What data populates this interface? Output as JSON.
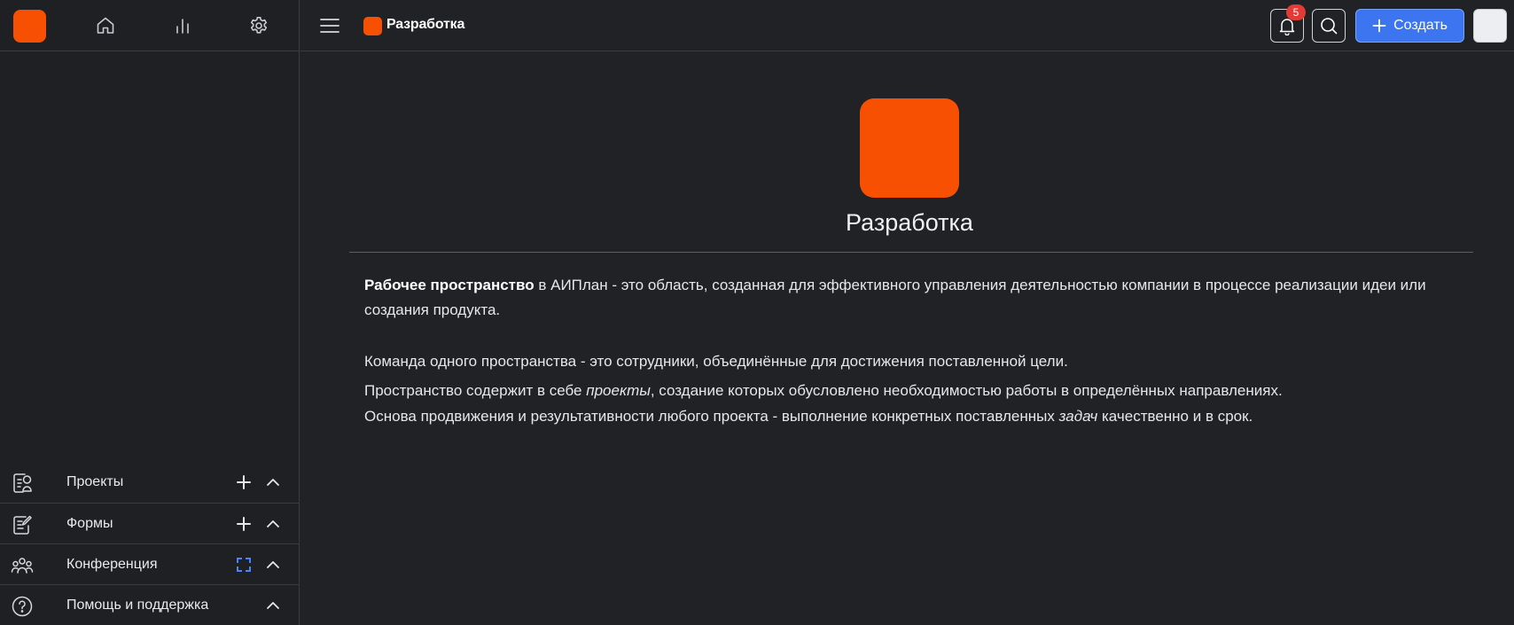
{
  "header": {
    "breadcrumb": "Разработка",
    "notifications_count": "5",
    "create_label": "Создать"
  },
  "sidebar": {
    "items": [
      {
        "label": "Проекты",
        "icon": "projects-icon",
        "action": "plus"
      },
      {
        "label": "Формы",
        "icon": "forms-icon",
        "action": "plus"
      },
      {
        "label": "Конференция",
        "icon": "people-icon",
        "action": "expand"
      },
      {
        "label": "Помощь и поддержка",
        "icon": "help-icon",
        "action": "none"
      }
    ]
  },
  "workspace": {
    "title": "Разработка",
    "p1_bold": "Рабочее пространство",
    "p1_rest": " в АИПлан - это область, созданная для эффективного управления деятельностью компании в процессе реализации идеи или создания продукта.",
    "p2": "Команда одного пространства - это сотрудники, объединённые для достижения поставленной цели.",
    "p3_a": "Пространство содержит в себе ",
    "p3_b": "проекты",
    "p3_c": ", создание которых обусловлено необходимостью работы в определённых направлениях.",
    "p4_a": "Основа продвижения и результативности любого проекта - выполнение конкретных поставленных ",
    "p4_b": "задач",
    "p4_c": " качественно и в срок."
  },
  "colors": {
    "accent_orange": "#f75002",
    "primary_blue": "#3d75f0",
    "background": "#202226",
    "badge_red": "#e53935"
  }
}
